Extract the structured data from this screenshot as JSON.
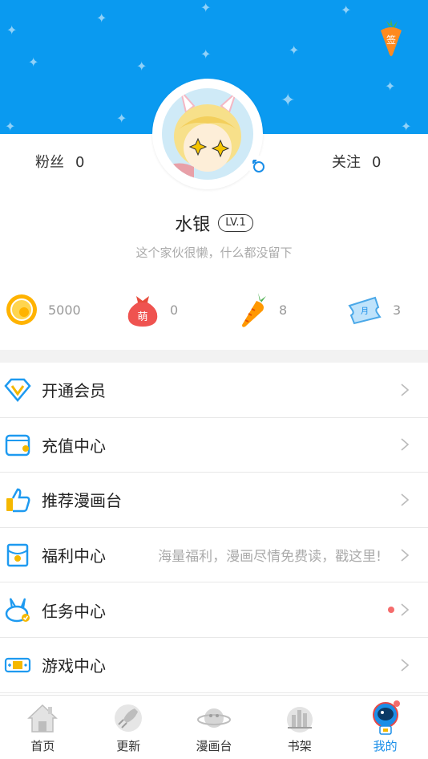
{
  "profile": {
    "fans_label": "粉丝",
    "fans_count": "0",
    "follow_label": "关注",
    "follow_count": "0",
    "username": "水银",
    "level": "LV.1",
    "bio": "这个家伙很懒，什么都没留下",
    "checkin_label": "签"
  },
  "assets": [
    {
      "icon": "coin-icon",
      "value": "5000"
    },
    {
      "icon": "moe-bag-icon",
      "value": "0",
      "icon_text": "萌"
    },
    {
      "icon": "carrot-icon",
      "value": "8"
    },
    {
      "icon": "monthly-ticket-icon",
      "value": "3",
      "icon_text": "月"
    }
  ],
  "menu": [
    {
      "label": "开通会员",
      "icon": "diamond-vip-icon"
    },
    {
      "label": "充值中心",
      "icon": "wallet-icon"
    },
    {
      "label": "推荐漫画台",
      "icon": "thumbs-up-icon"
    },
    {
      "label": "福利中心",
      "icon": "envelope-icon",
      "hint": "海量福利，漫画尽情免费读，戳这里!"
    },
    {
      "label": "任务中心",
      "icon": "bunny-task-icon",
      "has_dot": true
    },
    {
      "label": "游戏中心",
      "icon": "gamepad-icon"
    }
  ],
  "tabs": [
    {
      "label": "首页",
      "icon": "home-icon"
    },
    {
      "label": "更新",
      "icon": "rocket-icon"
    },
    {
      "label": "漫画台",
      "icon": "planet-icon"
    },
    {
      "label": "书架",
      "icon": "bookshelf-icon"
    },
    {
      "label": "我的",
      "icon": "astronaut-icon",
      "active": true,
      "has_dot": true
    }
  ],
  "colors": {
    "header_blue": "#0a9af0",
    "active_tab": "#1a8ee8",
    "badge_dot": "#f56c6c"
  }
}
